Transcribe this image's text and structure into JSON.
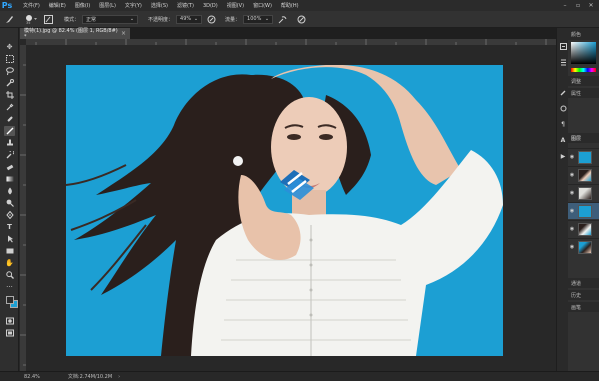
{
  "app": {
    "logo": "Ps"
  },
  "menubar": {
    "items": [
      "文件(F)",
      "编辑(E)",
      "图像(I)",
      "图层(L)",
      "文字(Y)",
      "选择(S)",
      "滤镜(T)",
      "3D(D)",
      "视图(V)",
      "窗口(W)",
      "帮助(H)"
    ]
  },
  "options": {
    "brush_size": "35",
    "mode_label": "模式：",
    "mode_value": "正常",
    "opacity_label": "不透明度：",
    "opacity_value": "49%",
    "flow_label": "流量：",
    "flow_value": "100%"
  },
  "document": {
    "tab_title": "模特(1).jpg @ 82.4% (图层 1, RGB/8#) *"
  },
  "status": {
    "zoom": "82.4%",
    "doc_info": "文档:2.74M/10.2M"
  },
  "panels": {
    "adjust_label": "调整",
    "properties_label": "属性",
    "layers_label": "图层",
    "channels_label": "通道",
    "history_label": "历史",
    "brush_label": "画笔",
    "color_label": "颜色"
  },
  "colors": {
    "accent": "#31a8ff",
    "canvas_bg": "#1c9fd3",
    "chrome_dark": "#282828",
    "chrome_mid": "#323232",
    "foreground_swatch": "#2b2b2b",
    "background_swatch": "#1c9fd3"
  },
  "tools": [
    "move-icon",
    "marquee-icon",
    "lasso-icon",
    "quick-select-icon",
    "crop-icon",
    "eyedropper-icon",
    "healing-icon",
    "brush-icon",
    "clone-stamp-icon",
    "history-brush-icon",
    "eraser-icon",
    "gradient-icon",
    "blur-icon",
    "dodge-icon",
    "pen-icon",
    "type-icon",
    "path-select-icon",
    "shape-icon",
    "hand-icon",
    "zoom-icon"
  ]
}
